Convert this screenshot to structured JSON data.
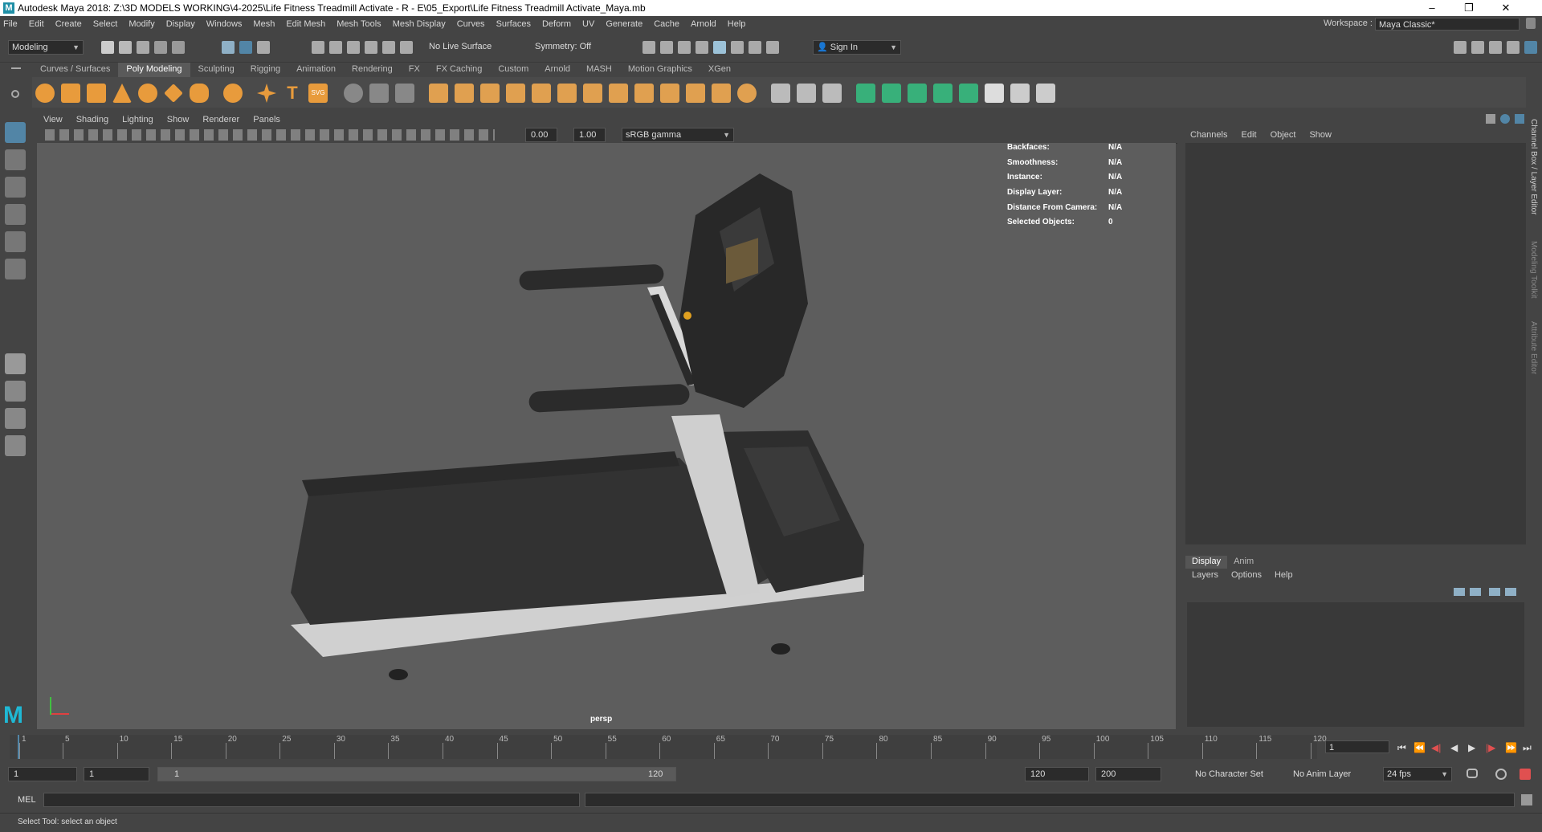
{
  "window": {
    "title": "Autodesk Maya 2018: Z:\\3D MODELS WORKING\\4-2025\\Life Fitness Treadmill Activate - R - E\\05_Export\\Life Fitness Treadmill Activate_Maya.mb",
    "logo": "M",
    "minimize": "–",
    "restore": "❐",
    "close": "✕"
  },
  "menubar": {
    "items": [
      "File",
      "Edit",
      "Create",
      "Select",
      "Modify",
      "Display",
      "Windows",
      "Mesh",
      "Edit Mesh",
      "Mesh Tools",
      "Mesh Display",
      "Curves",
      "Surfaces",
      "Deform",
      "UV",
      "Generate",
      "Cache",
      "Arnold",
      "Help"
    ],
    "workspace_label": "Workspace :",
    "workspace_value": "Maya Classic*"
  },
  "statusline": {
    "mode": "Modeling",
    "live_surface": "No Live Surface",
    "symmetry": "Symmetry: Off",
    "sign_in": "Sign In"
  },
  "shelf": {
    "tabs": [
      "Curves / Surfaces",
      "Poly Modeling",
      "Sculpting",
      "Rigging",
      "Animation",
      "Rendering",
      "FX",
      "FX Caching",
      "Custom",
      "Arnold",
      "MASH",
      "Motion Graphics",
      "XGen"
    ],
    "active_tab": "Poly Modeling"
  },
  "viewport": {
    "menus": [
      "View",
      "Shading",
      "Lighting",
      "Show",
      "Renderer",
      "Panels"
    ],
    "exposure": "0.00",
    "gamma": "1.00",
    "color_space": "sRGB gamma",
    "camera": "persp",
    "hud": [
      {
        "label": "Backfaces:",
        "value": "N/A"
      },
      {
        "label": "Smoothness:",
        "value": "N/A"
      },
      {
        "label": "Instance:",
        "value": "N/A"
      },
      {
        "label": "Display Layer:",
        "value": "N/A"
      },
      {
        "label": "Distance From Camera:",
        "value": "N/A"
      },
      {
        "label": "Selected Objects:",
        "value": "0"
      }
    ]
  },
  "channel_box": {
    "menus": [
      "Channels",
      "Edit",
      "Object",
      "Show"
    ]
  },
  "layer_editor": {
    "tabs": [
      "Display",
      "Anim"
    ],
    "active_tab": "Display",
    "menus": [
      "Layers",
      "Options",
      "Help"
    ]
  },
  "side_tabs": [
    "Channel Box / Layer Editor",
    "Modeling Toolkit",
    "Attribute Editor"
  ],
  "timeline": {
    "ticks": [
      "1",
      "5",
      "10",
      "15",
      "20",
      "25",
      "30",
      "35",
      "40",
      "45",
      "50",
      "55",
      "60",
      "65",
      "70",
      "75",
      "80",
      "85",
      "90",
      "95",
      "100",
      "105",
      "110",
      "115",
      "120"
    ],
    "current_frame": "1"
  },
  "range": {
    "start": "1",
    "playback_start": "1",
    "slider_start": "1",
    "slider_end": "120",
    "playback_end": "120",
    "end": "200",
    "character_set": "No Character Set",
    "anim_layer": "No Anim Layer",
    "fps": "24 fps"
  },
  "commandline": {
    "label": "MEL"
  },
  "helpline": {
    "text": "Select Tool: select an object"
  },
  "colors": {
    "bg": "#444444",
    "viewport": "#5d5d5d",
    "accent": "#5285a6",
    "title_bar": "#ffffff"
  }
}
